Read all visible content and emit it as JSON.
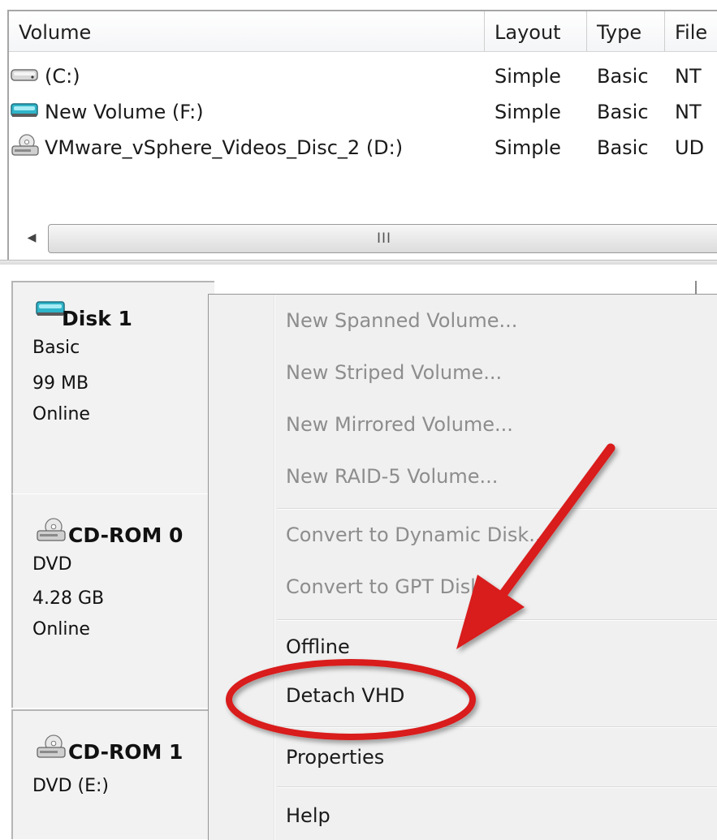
{
  "volume_list": {
    "columns": [
      "Volume",
      "Layout",
      "Type",
      "File"
    ],
    "rows": [
      {
        "volume": "(C:)",
        "layout": "Simple",
        "type": "Basic",
        "fs": "NT",
        "icon": "drive-gray-icon"
      },
      {
        "volume": "New Volume (F:)",
        "layout": "Simple",
        "type": "Basic",
        "fs": "NT",
        "icon": "drive-teal-icon"
      },
      {
        "volume": "VMware_vSphere_Videos_Disc_2 (D:)",
        "layout": "Simple",
        "type": "Basic",
        "fs": "UD",
        "icon": "cd-drive-icon"
      }
    ],
    "scrollbar_grip": "III"
  },
  "disks": [
    {
      "name": "Disk 1",
      "lines": [
        "Basic",
        "99 MB",
        "Online"
      ],
      "icon": "disk-teal-icon"
    },
    {
      "name": "CD-ROM 0",
      "lines": [
        "DVD",
        "4.28 GB",
        "Online"
      ],
      "icon": "cd-drive-icon"
    },
    {
      "name": "CD-ROM 1",
      "lines": [
        "DVD (E:)"
      ],
      "icon": "cd-drive-icon"
    }
  ],
  "context_menu": {
    "items": [
      {
        "label": "New Spanned Volume...",
        "enabled": false
      },
      {
        "label": "New Striped Volume...",
        "enabled": false
      },
      {
        "label": "New Mirrored Volume...",
        "enabled": false
      },
      {
        "label": "New RAID-5 Volume...",
        "enabled": false
      },
      {
        "label": "Convert to Dynamic Disk...",
        "enabled": false
      },
      {
        "label": "Convert to GPT Disk",
        "enabled": false
      },
      {
        "label": "Offline",
        "enabled": true
      },
      {
        "label": "Detach VHD",
        "enabled": true
      },
      {
        "label": "Properties",
        "enabled": true
      },
      {
        "label": "Help",
        "enabled": true
      }
    ]
  },
  "annotation": {
    "highlighted_item": "Detach VHD",
    "color": "#d91c1c"
  }
}
